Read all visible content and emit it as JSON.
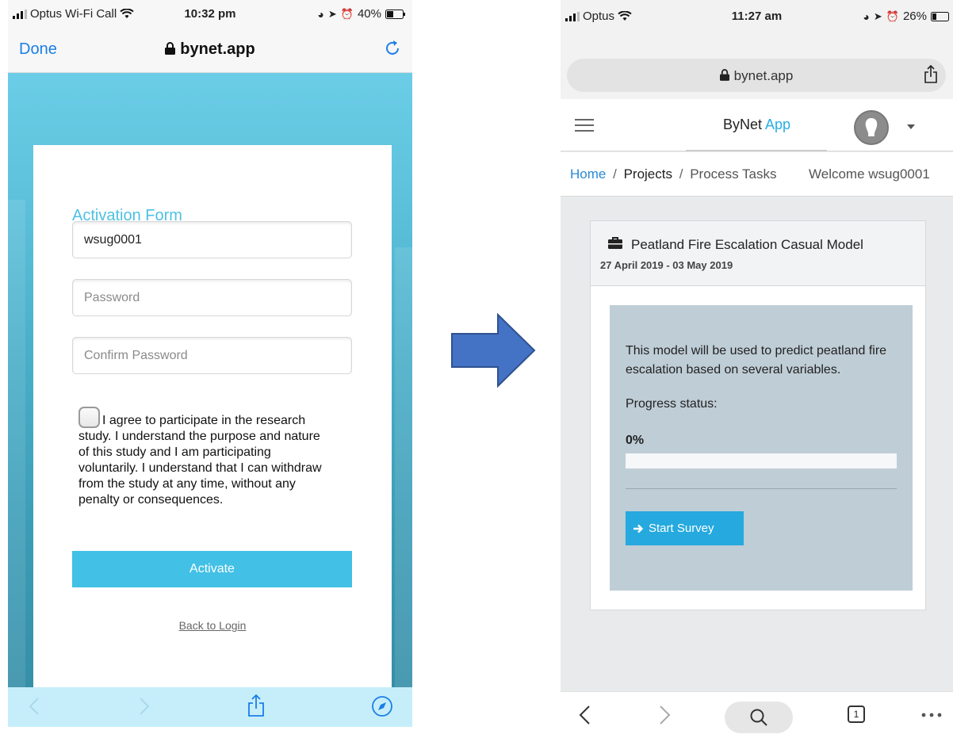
{
  "left_screen": {
    "status": {
      "carrier": "Optus Wi-Fi Call",
      "time": "10:32 pm",
      "battery": "40%"
    },
    "nav": {
      "done_label": "Done",
      "url": "bynet.app"
    },
    "form": {
      "title": "Activation Form",
      "username_value": "wsug0001",
      "password_placeholder": "Password",
      "confirm_placeholder": "Confirm Password",
      "agree_text": "I agree to participate in the research study. I understand the purpose and nature of this study and I am participating voluntarily. I understand that I can withdraw from the study at any time, without any penalty or consequences.",
      "agree_checked": false,
      "activate_label": "Activate",
      "back_label": "Back to Login"
    }
  },
  "right_screen": {
    "status": {
      "carrier": "Optus",
      "time": "11:27 am",
      "battery": "26%"
    },
    "url": "bynet.app",
    "header": {
      "brand_main": "ByNet",
      "brand_accent": "App"
    },
    "breadcrumb": {
      "home": "Home",
      "projects": "Projects",
      "tasks": "Process Tasks",
      "separator": "/",
      "welcome": "Welcome wsug0001"
    },
    "project": {
      "title": "Peatland Fire Escalation Casual Model",
      "dates": "27 April 2019 - 03 May 2019",
      "description": "This model will be used to predict peatland fire escalation based on several variables.",
      "progress_label": "Progress status:",
      "progress_text": "0%",
      "progress_fraction": 0,
      "start_label": "Start Survey"
    },
    "bottom_bar": {
      "tab_count": "1"
    }
  },
  "colors": {
    "accent": "#42c0e5",
    "link_blue": "#1a7ee8",
    "arrow_fill": "#4472c4",
    "arrow_stroke": "#2f528f",
    "card_body": "#bfcdd6"
  }
}
